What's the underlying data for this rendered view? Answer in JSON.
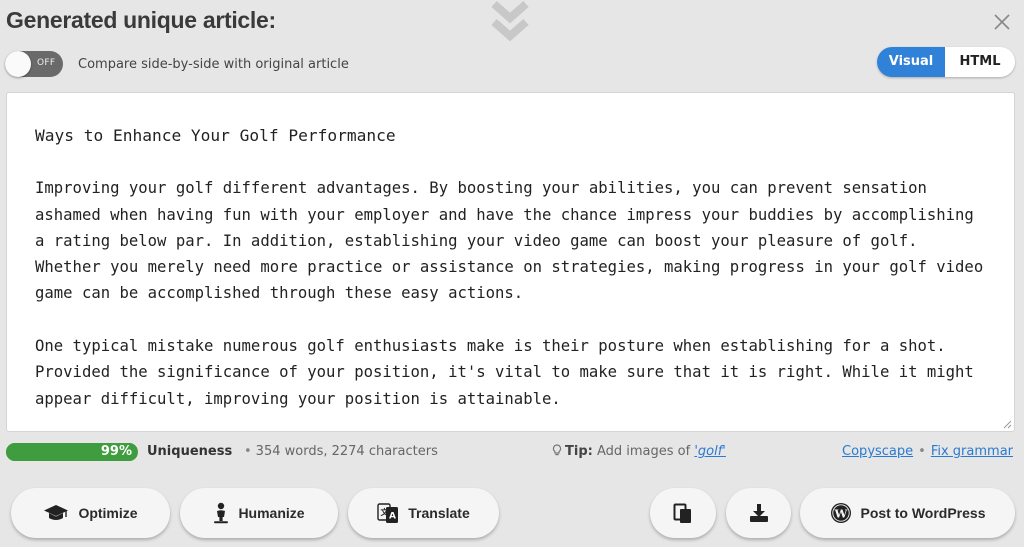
{
  "header": {
    "title": "Generated unique article:"
  },
  "compare": {
    "toggle_state": "OFF",
    "label": "Compare side-by-side with original article"
  },
  "view_switch": {
    "visual": "Visual",
    "html": "HTML",
    "selected": "Visual"
  },
  "article": {
    "heading": "Ways to Enhance Your Golf Performance",
    "paragraphs": [
      "Improving your golf different advantages. By boosting your abilities, you can prevent sensation ashamed when having fun with your employer and have the chance impress your buddies by accomplishing a rating below par. In addition, establishing your video game can boost your pleasure of golf. Whether you merely need more practice or assistance on strategies, making progress in your golf video game can be accomplished through these easy actions.",
      "One typical mistake numerous golf enthusiasts make is their posture when establishing for a shot. Provided the significance of your position, it's vital to make sure that it is right. While it might appear difficult, improving your position is attainable."
    ]
  },
  "status": {
    "uniqueness_percent": 99,
    "uniqueness_text": "99%",
    "uniqueness_label": "Uniqueness",
    "counts": "354 words, 2274 characters",
    "tip_label": "Tip:",
    "tip_text": "Add images of",
    "tip_keyword": "'golf'",
    "copyscape": "Copyscape",
    "fix_grammar": "Fix grammar"
  },
  "actions": {
    "optimize": "Optimize",
    "humanize": "Humanize",
    "translate": "Translate",
    "post": "Post to WordPress"
  },
  "colors": {
    "accent": "#3081d8",
    "progress": "#3f9d3f",
    "link": "#2a7ad1"
  }
}
